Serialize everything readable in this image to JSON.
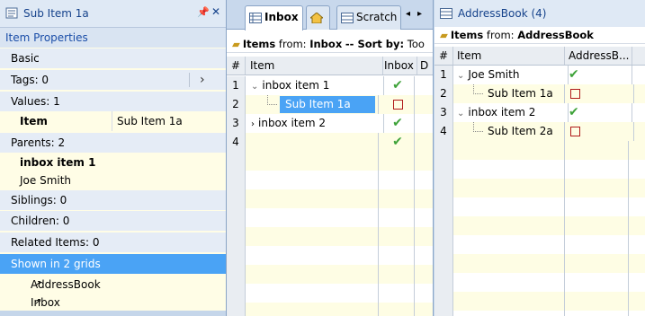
{
  "properties_panel": {
    "title": "Sub Item 1a",
    "header": "Item Properties",
    "rows": {
      "basic": "Basic",
      "tags": "Tags: 0",
      "values": "Values: 1",
      "item_key": "Item",
      "item_value": "Sub Item 1a",
      "parents": "Parents: 2",
      "parent1": "inbox item 1",
      "parent2": "Joe Smith",
      "siblings": "Siblings: 0",
      "children": "Children: 0",
      "related": "Related Items: 0",
      "shown": "Shown in 2 grids",
      "grid1": "AddressBook",
      "grid2": "Inbox"
    }
  },
  "inbox_grid": {
    "tabs": [
      "Inbox",
      "Scratch"
    ],
    "info_prefix": "Items",
    "info_from": "from:",
    "info_source": "Inbox",
    "info_sort": "-- Sort by:",
    "info_sortval": "Too",
    "columns": [
      "#",
      "Item",
      "Inbox",
      "D"
    ],
    "rows": [
      {
        "num": "1",
        "item": "inbox item 1",
        "check": true
      },
      {
        "num": "2",
        "item": "Sub Item 1a",
        "check": false
      },
      {
        "num": "3",
        "item": "inbox item 2",
        "check": true
      },
      {
        "num": "4",
        "item": "",
        "check": true
      }
    ]
  },
  "address_grid": {
    "title": "AddressBook (4)",
    "info_prefix": "Items",
    "info_from": "from:",
    "info_source": "AddressBook",
    "columns": [
      "#",
      "Item",
      "AddressB..."
    ],
    "rows": [
      {
        "num": "1",
        "item": "Joe Smith",
        "check": true
      },
      {
        "num": "2",
        "item": "Sub Item 1a",
        "check": false
      },
      {
        "num": "3",
        "item": "inbox item 2",
        "check": true
      },
      {
        "num": "4",
        "item": "Sub Item 2a",
        "check": false
      }
    ]
  },
  "colors": {
    "selection": "#4aa3f5",
    "check": "#3fa33a",
    "uncheck": "#b01a1a"
  }
}
